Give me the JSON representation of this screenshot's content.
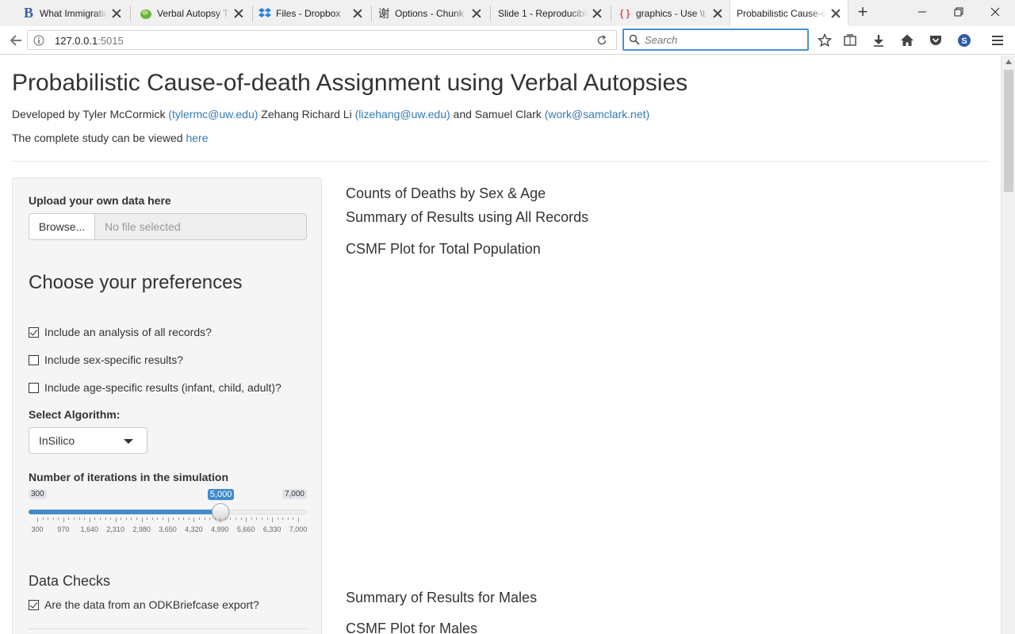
{
  "browser": {
    "tabs": [
      {
        "label": "What Immigratio",
        "icon": "bootstrap-b-icon"
      },
      {
        "label": "Verbal Autopsy T",
        "icon": "green-leaf-icon"
      },
      {
        "label": "Files - Dropbox",
        "icon": "dropbox-icon"
      },
      {
        "label": "Options - Chunk",
        "icon": "chinese-character-icon"
      },
      {
        "label": "Slide 1 - Reproducible",
        "icon": "slide-icon"
      },
      {
        "label": "graphics - Use \\t",
        "icon": "braces-icon"
      },
      {
        "label": "Probabilistic Cause-o",
        "icon": "none",
        "active": true
      }
    ],
    "url": {
      "host": "127.0.0.1",
      "port": ":5015"
    },
    "search_placeholder": "Search"
  },
  "page": {
    "title": "Probabilistic Cause-of-death Assignment using Verbal Autopsies",
    "credits": {
      "prefix": "Developed by Tyler McCormick ",
      "email1": "(tylermc@uw.edu)",
      "mid1": " Zehang Richard Li ",
      "email2": "(lizehang@uw.edu)",
      "mid2": " and Samuel Clark ",
      "email3": "(work@samclark.net)"
    },
    "study": {
      "prefix": "The complete study can be viewed ",
      "link": "here"
    }
  },
  "sidebar": {
    "upload_label": "Upload your own data here",
    "browse_label": "Browse...",
    "file_placeholder": "No file selected",
    "preferences_heading": "Choose your preferences",
    "checkboxes": [
      {
        "label": "Include an analysis of all records?",
        "checked": true
      },
      {
        "label": "Include sex-specific results?",
        "checked": false
      },
      {
        "label": "Include age-specific results (infant, child, adult)?",
        "checked": false
      }
    ],
    "algorithm_label": "Select Algorithm:",
    "algorithm_value": "InSilico",
    "iterations_label": "Number of iterations in the simulation",
    "slider": {
      "min_label": "300",
      "max_label": "7,000",
      "value_label": "5,000",
      "min": 300,
      "max": 7000,
      "value": 5000,
      "tick_labels": [
        "300",
        "970",
        "1,640",
        "2,310",
        "2,980",
        "3,650",
        "4,320",
        "4,990",
        "5,660",
        "6,330",
        "7,000"
      ]
    },
    "data_checks_heading": "Data Checks",
    "odk_label": "Are the data from an ODKBriefcase export?",
    "odk_checked": true
  },
  "main": {
    "headings": [
      "Counts of Deaths by Sex & Age",
      "Summary of Results using All Records",
      "CSMF Plot for Total Population",
      "Summary of Results for Males",
      "CSMF Plot for Males"
    ]
  },
  "colors": {
    "link": "#337ab7",
    "slider": "#428bca",
    "search_focus": "#4a90d9"
  }
}
